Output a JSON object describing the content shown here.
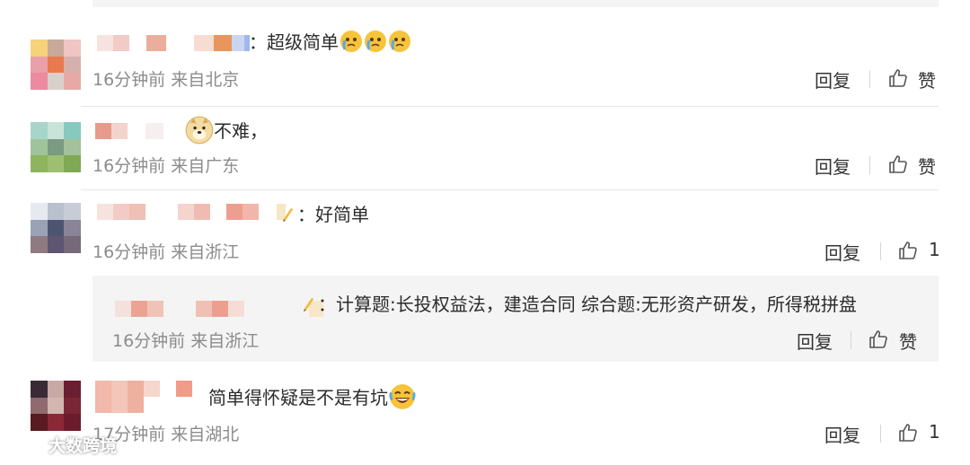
{
  "comments": [
    {
      "text": "：超级简单",
      "meta": "16分钟前 来自北京",
      "reply_label": "回复",
      "like_label": "赞",
      "emoji": "crying-face-icon"
    },
    {
      "text": "不难，",
      "meta": "16分钟前 来自广东",
      "reply_label": "回复",
      "like_label": "赞",
      "emoji": "doge-face-icon"
    },
    {
      "text": "：好简单",
      "meta": "16分钟前 来自浙江",
      "reply_label": "回复",
      "like_label": "1",
      "emoji": "pencil-icon"
    },
    {
      "text": "简单得怀疑是不是有坑",
      "meta": "17分钟前 来自湖北",
      "reply_label": "回复",
      "like_label": "1",
      "emoji": "laughing-tears-icon"
    }
  ],
  "sub_reply": {
    "text": "：计算题:长投权益法，建造合同 综合题:无形资产研发，所得税拼盘",
    "meta": "16分钟前 来自浙江",
    "reply_label": "回复",
    "like_label": "赞"
  },
  "watermark": "大数跨境",
  "colors": {
    "meta_gray": "#8c8c8c",
    "sub_box_bg": "#f4f4f4",
    "divider": "#e6e6e6"
  }
}
